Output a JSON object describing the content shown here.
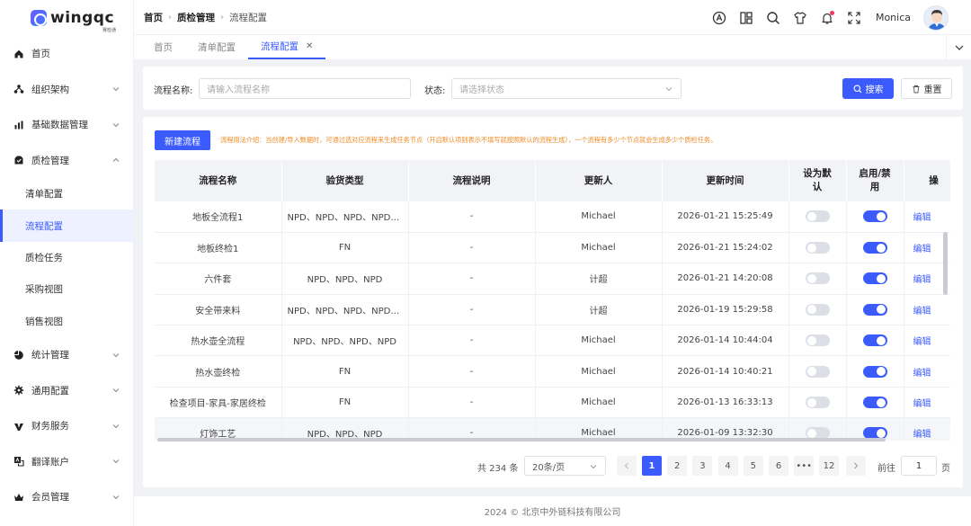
{
  "brand": {
    "logo_text": "wingqc",
    "logo_sub": "赛检通"
  },
  "sidebar": {
    "items": [
      {
        "label": "首页",
        "icon": "home-icon",
        "has_chevron": false
      },
      {
        "label": "组织架构",
        "icon": "org-icon",
        "has_chevron": true
      },
      {
        "label": "基础数据管理",
        "icon": "chart-icon",
        "has_chevron": true
      },
      {
        "label": "质检管理",
        "icon": "inspect-icon",
        "has_chevron": true,
        "expanded": true
      }
    ],
    "sub_items": [
      {
        "label": "清单配置",
        "active": false
      },
      {
        "label": "流程配置",
        "active": true
      },
      {
        "label": "质检任务",
        "active": false
      },
      {
        "label": "采购视图",
        "active": false
      },
      {
        "label": "销售视图",
        "active": false
      }
    ],
    "items_after": [
      {
        "label": "统计管理",
        "icon": "pie-icon"
      },
      {
        "label": "通用配置",
        "icon": "gear-icon"
      },
      {
        "label": "财务服务",
        "icon": "finance-icon"
      },
      {
        "label": "翻译账户",
        "icon": "translate-icon"
      },
      {
        "label": "会员管理",
        "icon": "crown-icon"
      }
    ]
  },
  "header": {
    "breadcrumb": [
      "首页",
      "质检管理",
      "流程配置"
    ],
    "username": "Monica"
  },
  "tabs": [
    {
      "label": "首页",
      "active": false
    },
    {
      "label": "清单配置",
      "active": false
    },
    {
      "label": "流程配置",
      "active": true,
      "closable": true
    }
  ],
  "filter": {
    "name_label": "流程名称:",
    "name_placeholder": "请输入流程名称",
    "status_label": "状态:",
    "status_placeholder": "请选择状态",
    "search_label": "搜索",
    "reset_label": "重置"
  },
  "toolbar": {
    "new_label": "新建流程",
    "hint": "流程用法介绍：当创建/导入数据时，可通过选对应流程来生成任务节点（开启默认项则表示不填写就按照默认的流程生成），一个流程有多少个节点就会生成多少个质检任务。"
  },
  "table": {
    "columns": [
      "流程名称",
      "验货类型",
      "流程说明",
      "更新人",
      "更新时间",
      "设为默认",
      "启用/禁用",
      "操"
    ],
    "rows": [
      {
        "name": "地板全流程1",
        "type": "NPD、NPD、NPD、NPD、NPD",
        "desc": "-",
        "updater": "Michael",
        "time": "2026-01-21 15:25:49",
        "default": false,
        "enabled": true,
        "action": "编辑"
      },
      {
        "name": "地板终检1",
        "type": "FN",
        "desc": "-",
        "updater": "Michael",
        "time": "2026-01-21 15:24:02",
        "default": false,
        "enabled": true,
        "action": "编辑"
      },
      {
        "name": "六件套",
        "type": "NPD、NPD、NPD",
        "desc": "-",
        "updater": "计超",
        "time": "2026-01-21 14:20:08",
        "default": false,
        "enabled": true,
        "action": "编辑"
      },
      {
        "name": "安全带来料",
        "type": "NPD、NPD、NPD、NPD、NPD",
        "desc": "-",
        "updater": "计超",
        "time": "2026-01-19 15:29:58",
        "default": false,
        "enabled": true,
        "action": "编辑"
      },
      {
        "name": "热水壶全流程",
        "type": "NPD、NPD、NPD、NPD",
        "desc": "-",
        "updater": "Michael",
        "time": "2026-01-14 10:44:04",
        "default": false,
        "enabled": true,
        "action": "编辑"
      },
      {
        "name": "热水壶终检",
        "type": "FN",
        "desc": "-",
        "updater": "Michael",
        "time": "2026-01-14 10:40:21",
        "default": false,
        "enabled": true,
        "action": "编辑"
      },
      {
        "name": "检查项目-家具-家居终检",
        "type": "FN",
        "desc": "-",
        "updater": "Michael",
        "time": "2026-01-13 16:33:13",
        "default": false,
        "enabled": true,
        "action": "编辑"
      },
      {
        "name": "灯饰工艺",
        "type": "NPD、NPD、NPD",
        "desc": "-",
        "updater": "Michael",
        "time": "2026-01-09 13:32:30",
        "default": false,
        "enabled": true,
        "action": "编辑"
      }
    ]
  },
  "pagination": {
    "total_text": "共 234 条",
    "page_size": "20条/页",
    "pages": [
      "1",
      "2",
      "3",
      "4",
      "5",
      "6",
      "•••",
      "12"
    ],
    "current": "1",
    "goto_label": "前往",
    "goto_value": "1",
    "page_suffix": "页"
  },
  "footer": {
    "text": "2024 © 北京中外链科技有限公司"
  },
  "colors": {
    "primary": "#3b5bfd",
    "hint": "#f08a24"
  }
}
